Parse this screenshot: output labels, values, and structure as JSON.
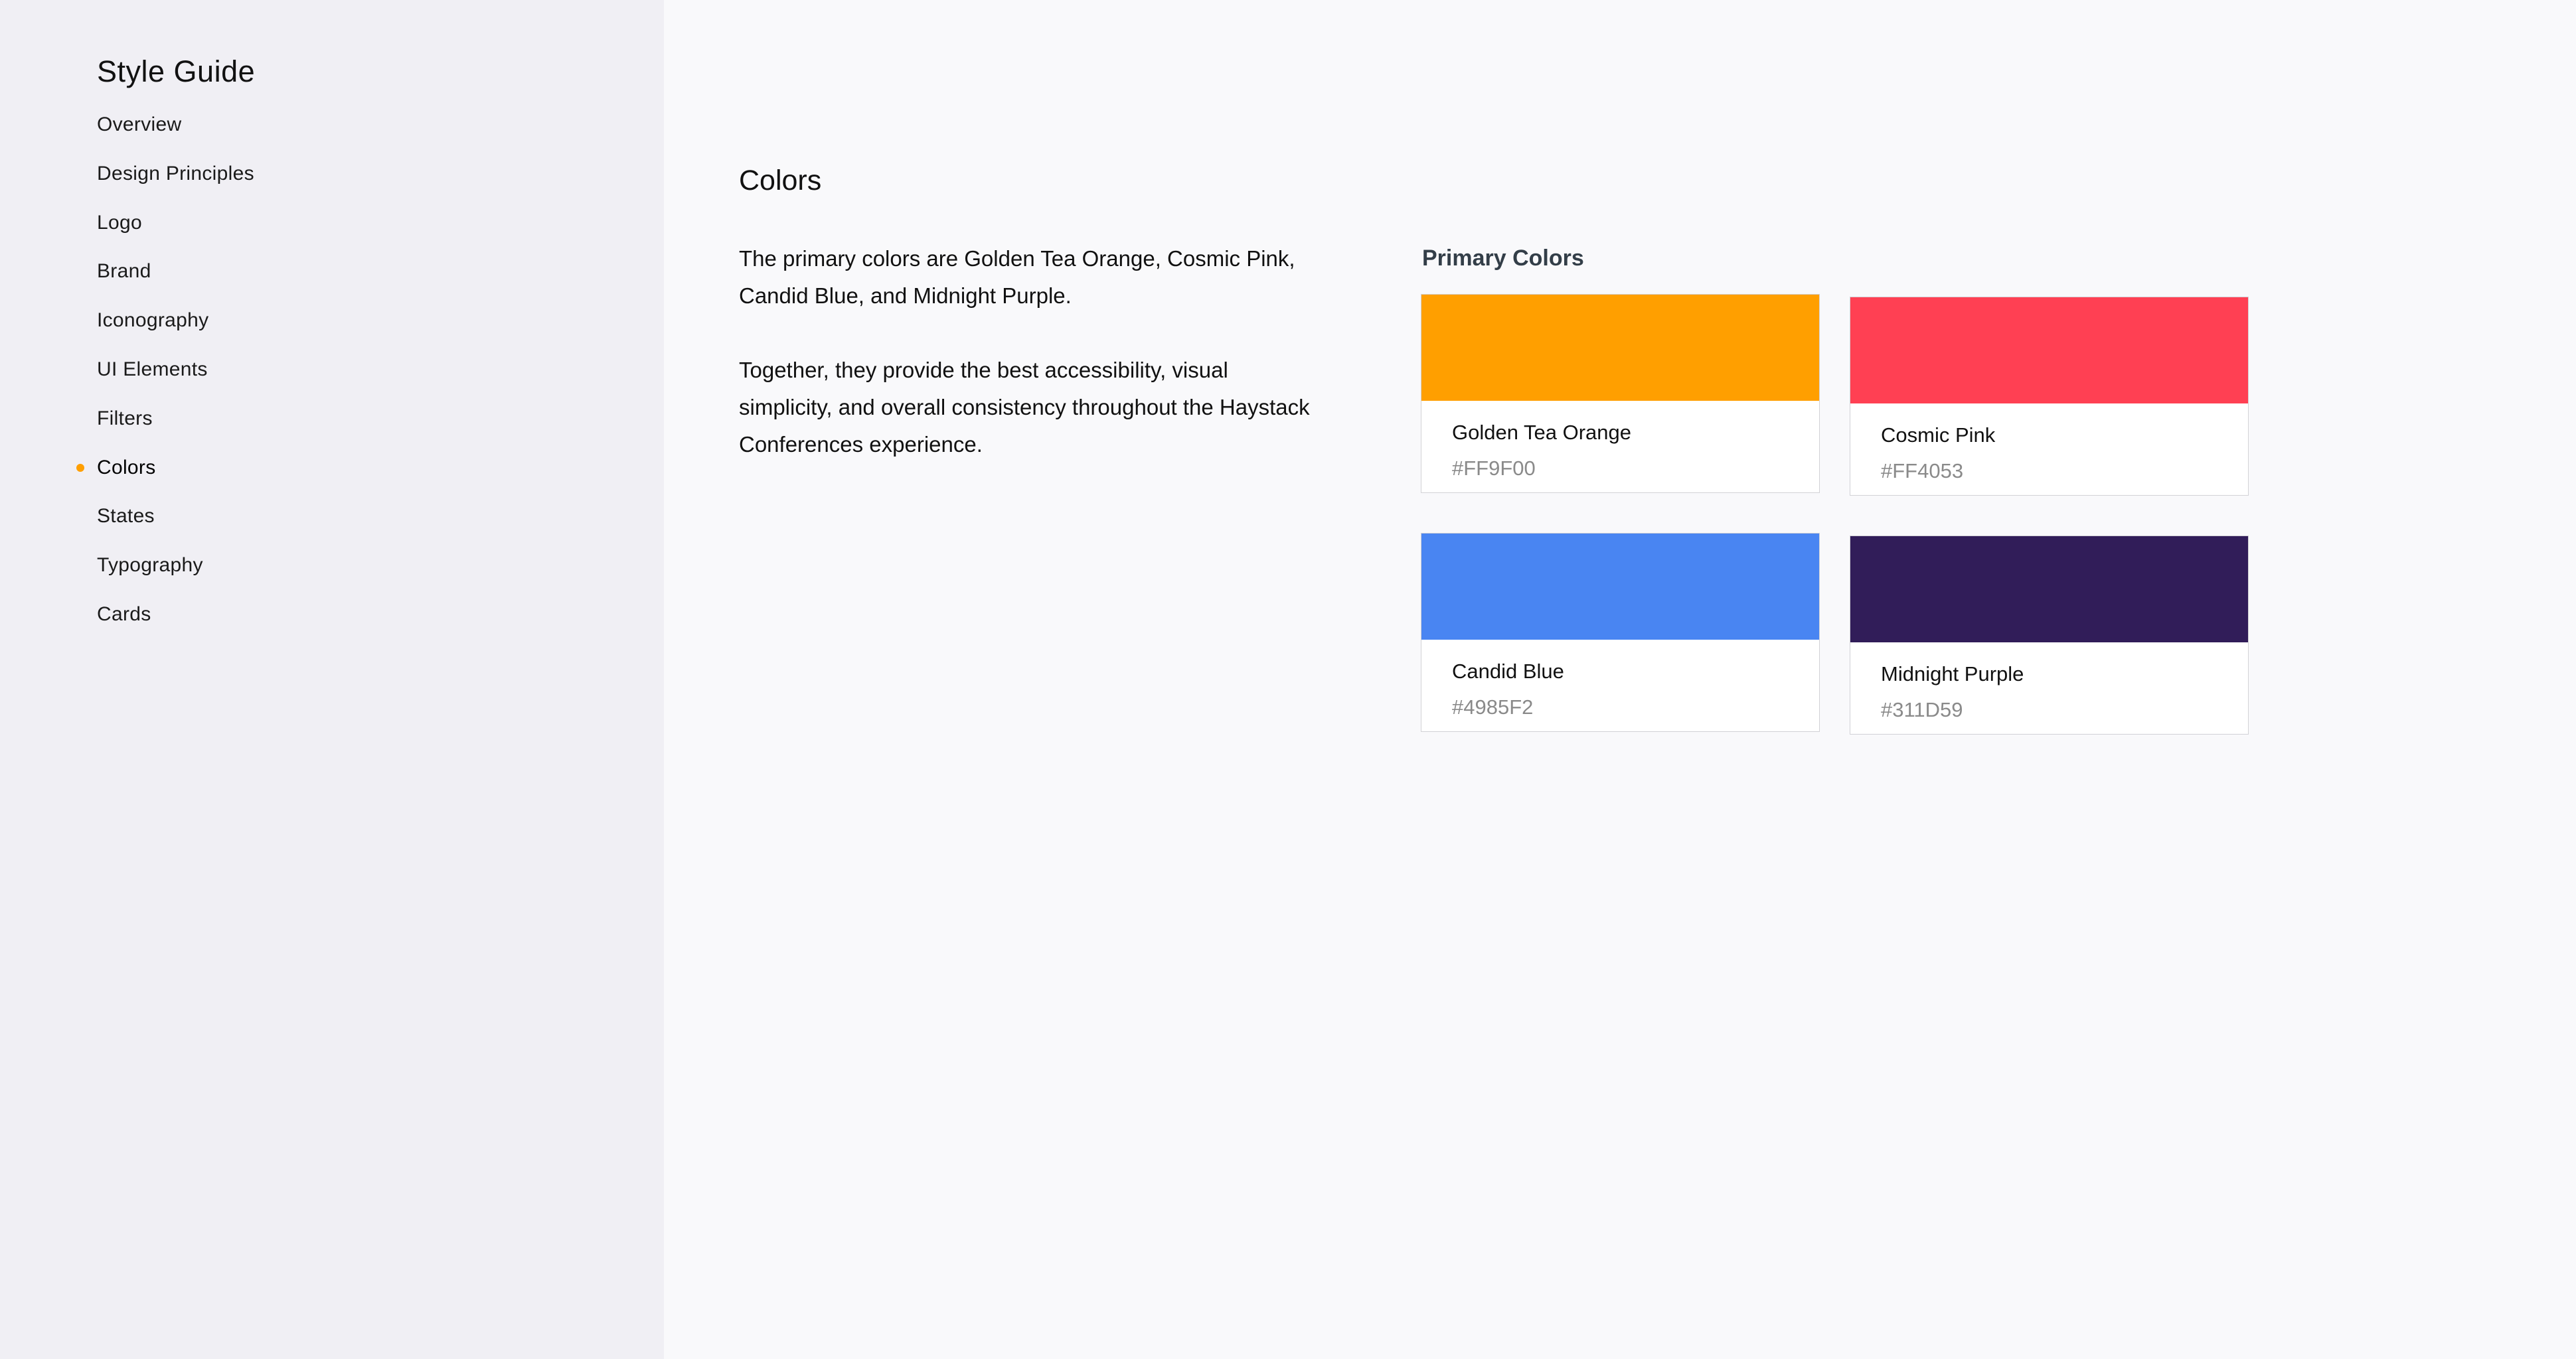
{
  "sidebar": {
    "title": "Style Guide",
    "active_bullet_color": "#FF9F00",
    "items": [
      {
        "label": "Overview",
        "active": false
      },
      {
        "label": "Design Principles",
        "active": false
      },
      {
        "label": "Logo",
        "active": false
      },
      {
        "label": "Brand",
        "active": false
      },
      {
        "label": "Iconography",
        "active": false
      },
      {
        "label": "UI Elements",
        "active": false
      },
      {
        "label": "Filters",
        "active": false
      },
      {
        "label": "Colors",
        "active": true
      },
      {
        "label": "States",
        "active": false
      },
      {
        "label": "Typography",
        "active": false
      },
      {
        "label": "Cards",
        "active": false
      }
    ]
  },
  "main": {
    "title": "Colors",
    "paragraphs": [
      "The primary colors are Golden Tea Orange, Cosmic Pink, Candid Blue, and Midnight Purple.",
      "Together, they provide the best accessibility, visual simplicity, and overall consistency throughout the Haystack Conferences experience."
    ],
    "section_title": "Primary Colors",
    "colors": [
      {
        "name": "Golden Tea Orange",
        "hex": "#FF9F00"
      },
      {
        "name": "Cosmic Pink",
        "hex": "#FF4053"
      },
      {
        "name": "Candid Blue",
        "hex": "#4985F2"
      },
      {
        "name": "Midnight Purple",
        "hex": "#311D59"
      }
    ]
  }
}
